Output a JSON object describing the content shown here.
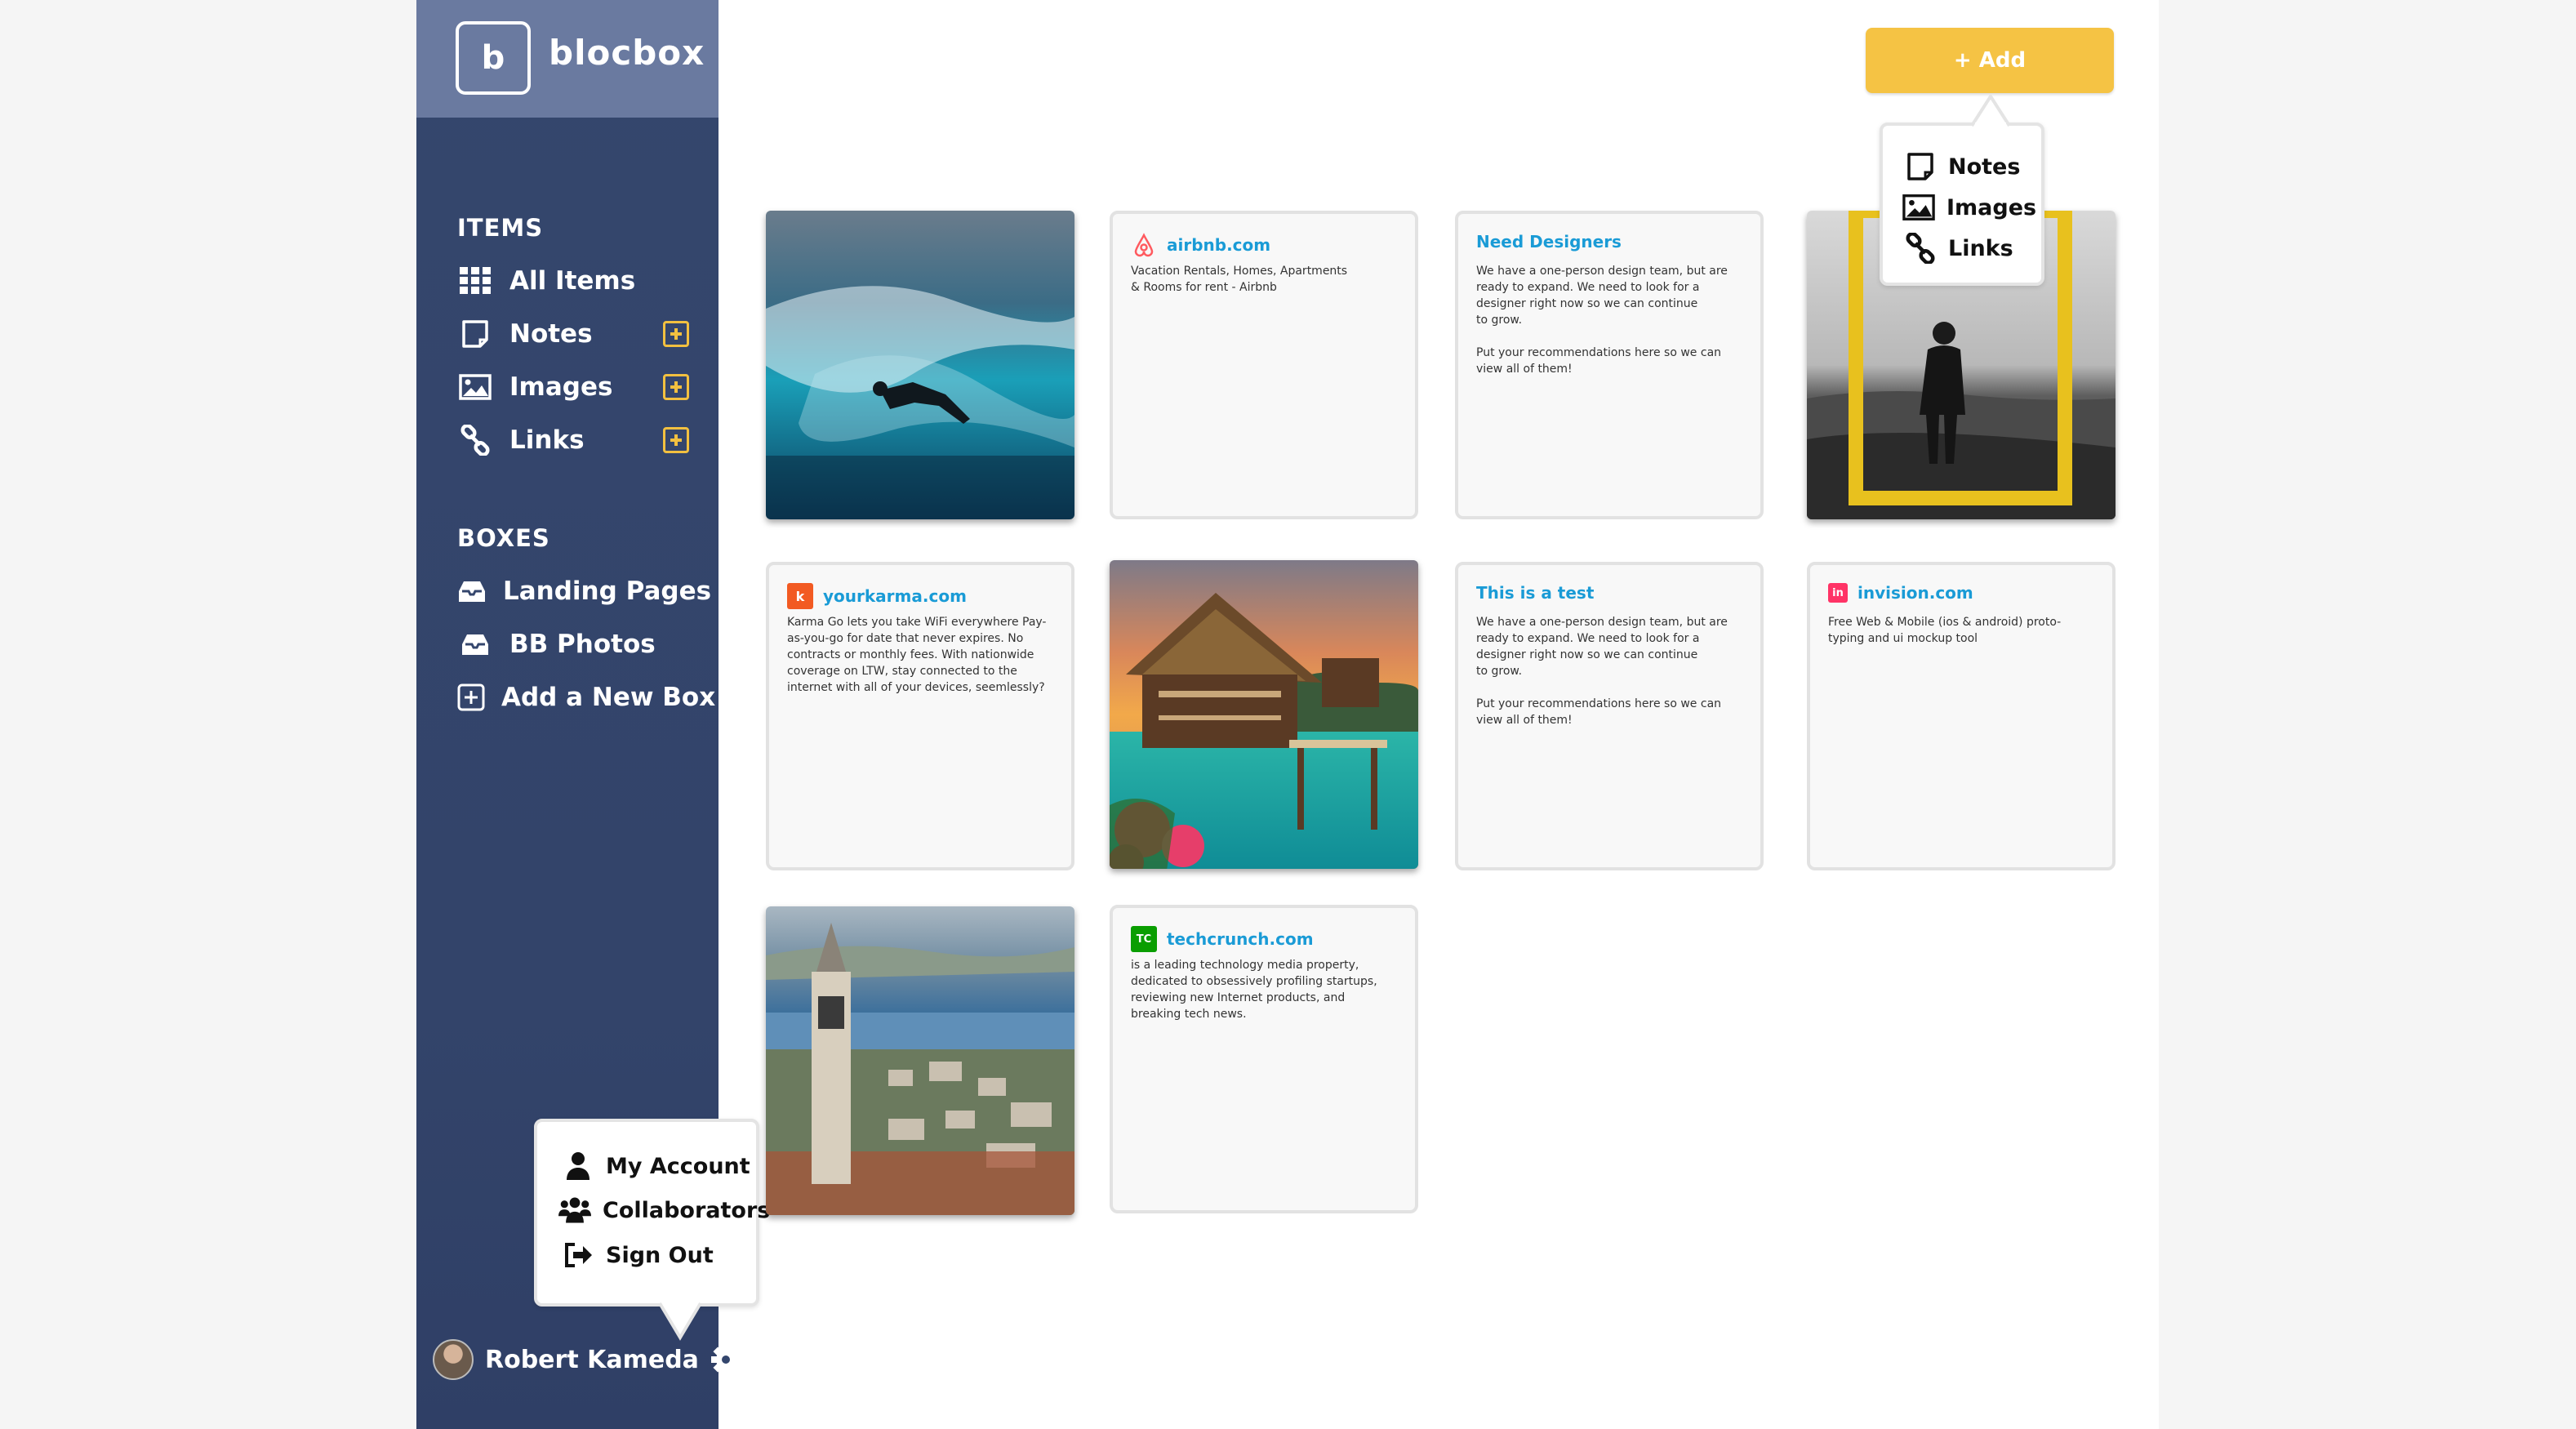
{
  "brand": {
    "letter": "b",
    "name": "blocbox"
  },
  "sidebar": {
    "items_title": "ITEMS",
    "items": [
      {
        "label": "All Items",
        "icon": "grid-icon"
      },
      {
        "label": "Notes",
        "icon": "note-icon"
      },
      {
        "label": "Images",
        "icon": "image-icon"
      },
      {
        "label": "Links",
        "icon": "link-icon"
      }
    ],
    "boxes_title": "BOXES",
    "boxes": [
      {
        "label": "Landing Pages",
        "icon": "inbox-icon"
      },
      {
        "label": "BB Photos",
        "icon": "inbox-icon"
      },
      {
        "label": "Add a New Box",
        "icon": "plus-square-icon"
      }
    ],
    "user_name": "Robert Kameda"
  },
  "account_menu": {
    "items": [
      "My Account",
      "Collaborators",
      "Sign Out"
    ]
  },
  "add_button": {
    "label": "+ Add"
  },
  "add_menu": {
    "items": [
      "Notes",
      "Images",
      "Links"
    ]
  },
  "cards": {
    "airbnb": {
      "title": "airbnb.com",
      "body": "Vacation Rentals, Homes, Apartments\n& Rooms for rent - Airbnb"
    },
    "need_designers": {
      "title": "Need Designers",
      "body": "We have a one-person design team, but are\nready to expand. We need to look for a\ndesigner right now so we can continue\nto grow.\n\nPut your recommendations here so we can\nview all of them!"
    },
    "yourkarma": {
      "title": "yourkarma.com",
      "body": "Karma Go lets you take WiFi everywhere Pay-\nas-you-go for date that never expires. No\ncontracts or monthly fees. With nationwide\ncoverage on LTW, stay connected to the\ninternet with all of your devices, seemlessly?"
    },
    "test": {
      "title": "This is a test",
      "body": "We have a one-person design team, but are\nready to expand. We need to look for a\ndesigner right now so we can continue\nto grow.\n\nPut your recommendations here so we can\nview all of them!"
    },
    "invision": {
      "title": "invision.com",
      "body": "Free Web & Mobile (ios & android) proto-\ntyping and ui mockup tool"
    },
    "techcrunch": {
      "title": "techcrunch.com",
      "body": "is a leading technology media property,\ndedicated to obsessively profiling startups,\nreviewing new Internet products, and\nbreaking tech news."
    }
  },
  "favicons": {
    "karma": "k",
    "invision": "in",
    "techcrunch": "TC"
  },
  "colors": {
    "sidebar": "#34466d",
    "brand_bar": "#6a7aa0",
    "accent": "#f5c344",
    "link_title": "#1a9bd6"
  }
}
